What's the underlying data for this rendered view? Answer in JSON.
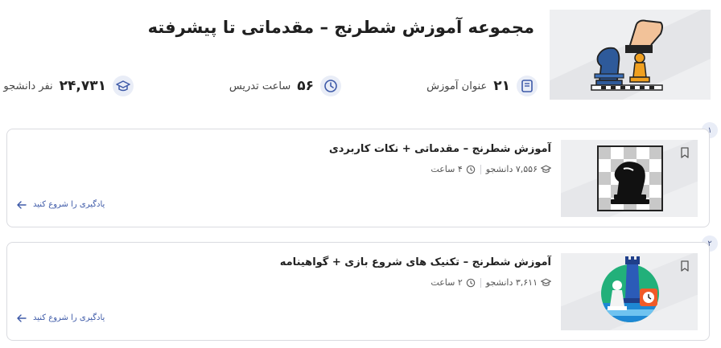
{
  "header": {
    "title": "مجموعه آموزش شطرنج – مقدماتی تا پیشرفته"
  },
  "stats": {
    "lessons_num": "۲۱",
    "lessons_label": "عنوان آموزش",
    "hours_num": "۵۶",
    "hours_label": "ساعت تدریس",
    "students_num": "۲۴,۷۳۱",
    "students_label": "نفر دانشجو"
  },
  "courses": [
    {
      "index": "۱",
      "title": "آموزش شطرنج – مقدماتی + نکات کاربردی",
      "students": "۷,۵۵۶ دانشجو",
      "hours": "۴ ساعت",
      "cta": "یادگیری را شروع کنید"
    },
    {
      "index": "۲",
      "title": "آموزش شطرنج – تکنیک های شروع بازی + گواهینامه",
      "students": "۳,۶۱۱ دانشجو",
      "hours": "۲ ساعت",
      "cta": "یادگیری را شروع کنید"
    }
  ],
  "colors": {
    "accent": "#3e5aa8",
    "icon_bg": "#e9edf7",
    "border": "#dadbe0"
  },
  "icons": {
    "lessons": "book-icon",
    "hours": "clock-icon",
    "students": "graduation-cap-icon",
    "bookmark": "bookmark-icon",
    "arrow": "arrow-left-icon"
  }
}
